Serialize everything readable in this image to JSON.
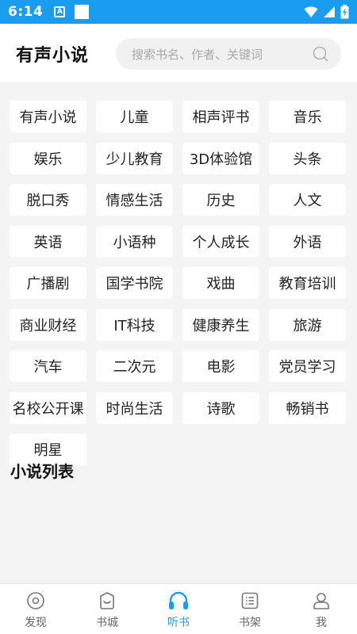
{
  "status_bar": {
    "time": "6:14",
    "notification_letter": "A"
  },
  "header": {
    "title": "有声小说",
    "search_placeholder": "搜索书名、作者、关键词"
  },
  "categories": [
    "有声小说",
    "儿童",
    "相声评书",
    "音乐",
    "娱乐",
    "少儿教育",
    "3D体验馆",
    "头条",
    "脱口秀",
    "情感生活",
    "历史",
    "人文",
    "英语",
    "小语种",
    "个人成长",
    "外语",
    "广播剧",
    "国学书院",
    "戏曲",
    "教育培训",
    "商业财经",
    "IT科技",
    "健康养生",
    "旅游",
    "汽车",
    "二次元",
    "电影",
    "党员学习",
    "名校公开课",
    "时尚生活",
    "诗歌",
    "畅销书",
    "明星"
  ],
  "section": {
    "title": "小说列表"
  },
  "bottom_nav": {
    "active": "听书",
    "items": [
      {
        "label": "发现",
        "icon": "compass-icon"
      },
      {
        "label": "书城",
        "icon": "bookstore-icon"
      },
      {
        "label": "听书",
        "icon": "headphones-icon"
      },
      {
        "label": "书架",
        "icon": "bookshelf-icon"
      },
      {
        "label": "我",
        "icon": "profile-icon"
      }
    ]
  },
  "colors": {
    "accent": "#1a9cf0",
    "background": "#f4f4f4",
    "card": "#ffffff"
  }
}
